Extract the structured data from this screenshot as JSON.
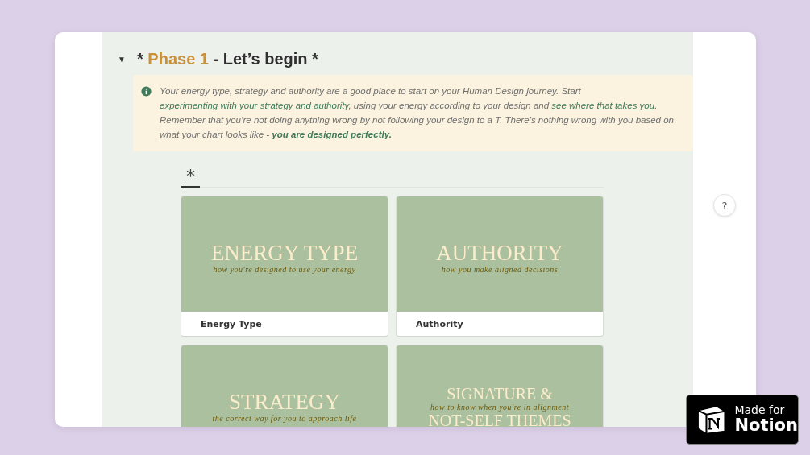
{
  "toggle": {
    "icon": "▼",
    "expanded": true
  },
  "heading": {
    "prefix": "*",
    "highlight": "Phase 1",
    "rest": "- Let’s begin *"
  },
  "callout": {
    "parts": [
      {
        "kind": "text",
        "text": "Your energy type, strategy and authority are a good place to start on your Human Design journey. Start "
      },
      {
        "kind": "link",
        "text": "experimenting with your strategy and authority"
      },
      {
        "kind": "text",
        "text": ", using your energy according to your design and "
      },
      {
        "kind": "link",
        "text": "see where that takes you"
      },
      {
        "kind": "text",
        "text": ". Remember that you’re not doing anything wrong by not following your design to a T. There’s nothing wrong with you based on what your chart looks like - "
      },
      {
        "kind": "bold",
        "text": "you are designed perfectly."
      }
    ]
  },
  "view_tab": {
    "label": "*",
    "selected": true
  },
  "cards": [
    {
      "cover_lines": [
        "ENERGY TYPE"
      ],
      "tagline": "how you're designed to use your energy",
      "name": "Energy Type"
    },
    {
      "cover_lines": [
        "AUTHORITY"
      ],
      "tagline": "how you make aligned decisions",
      "name": "Authority"
    },
    {
      "cover_lines": [
        "STRATEGY"
      ],
      "tagline": "the correct way for you to approach life"
    },
    {
      "cover_lines": [
        "SIGNATURE &",
        "NOT-SELF THEMES"
      ],
      "tagline": "how to know when you're in alignment"
    }
  ],
  "help_button": "?",
  "badge": {
    "line1": "Made for",
    "line2": "Notion"
  }
}
